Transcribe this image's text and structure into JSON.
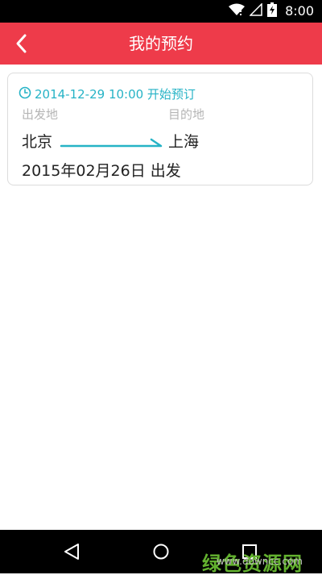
{
  "status_bar": {
    "time": "8:00",
    "icons": [
      "wifi-icon",
      "no-signal-icon",
      "battery-charging-icon"
    ]
  },
  "header": {
    "title": "我的预约",
    "back_icon": "chevron-left-icon"
  },
  "reservation": {
    "start_time": "2014-12-29 10:00 开始预订",
    "clock_icon": "clock-icon",
    "from_label": "出发地",
    "to_label": "目的地",
    "from_city": "北京",
    "to_city": "上海",
    "depart_date": "2015年02月26日 出发"
  },
  "nav_bar": {
    "icons": [
      "back-triangle-icon",
      "home-circle-icon",
      "recents-square-icon"
    ]
  },
  "watermark": {
    "main": "绿色资源网",
    "sub": "www.downcc.com"
  },
  "colors": {
    "accent": "#ee3b4a",
    "teal": "#26b3c6",
    "muted": "#b5b5b5",
    "watermark_green": "#63b22f"
  }
}
